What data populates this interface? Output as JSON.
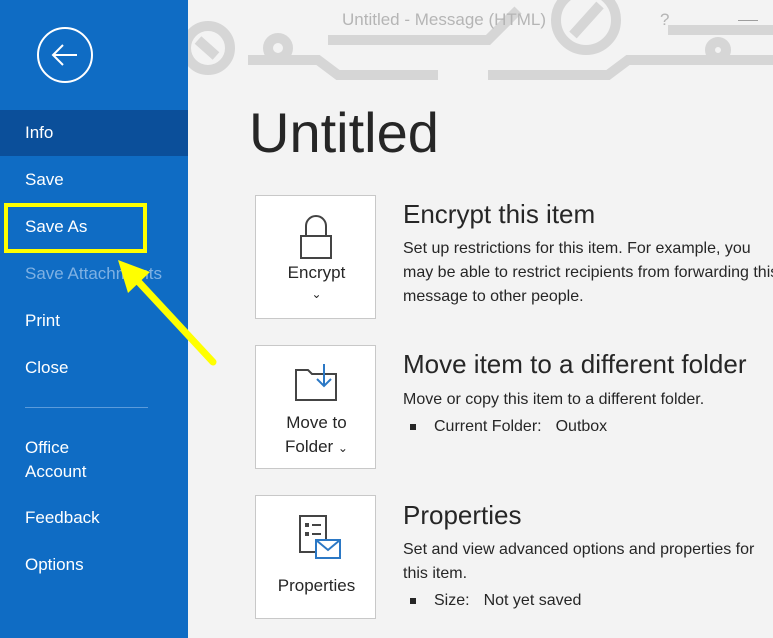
{
  "window": {
    "title": "Untitled  -  Message (HTML)",
    "help": "?"
  },
  "sidebar": {
    "items": [
      {
        "label": "Info"
      },
      {
        "label": "Save"
      },
      {
        "label": "Save As"
      },
      {
        "label": "Save Attachments"
      },
      {
        "label": "Print"
      },
      {
        "label": "Close"
      },
      {
        "label_line1": "Office",
        "label_line2": "Account"
      },
      {
        "label": "Feedback"
      },
      {
        "label": "Options"
      }
    ]
  },
  "main": {
    "title": "Untitled",
    "sections": [
      {
        "tile_line1": "Encrypt",
        "chevron": "⌄",
        "title": "Encrypt this item",
        "description": "Set up restrictions for this item. For example, you may be able to restrict recipients from forwarding this message to other people.",
        "icon": "lock-icon"
      },
      {
        "tile_line1": "Move to",
        "tile_line2": "Folder",
        "chevron": "⌄",
        "title": "Move item to a different folder",
        "description": "Move or copy this item to a different folder.",
        "bullet_label": "Current Folder:",
        "bullet_value": "Outbox",
        "icon": "folder-move-icon"
      },
      {
        "tile_line1": "Properties",
        "title": "Properties",
        "description": "Set and view advanced options and properties for this item.",
        "bullet_label": "Size:",
        "bullet_value": "Not yet saved",
        "icon": "properties-icon"
      }
    ]
  },
  "colors": {
    "sidebar": "#0f6cc4",
    "sidebar_active": "#0b4f9a",
    "highlight": "#ffff00"
  }
}
